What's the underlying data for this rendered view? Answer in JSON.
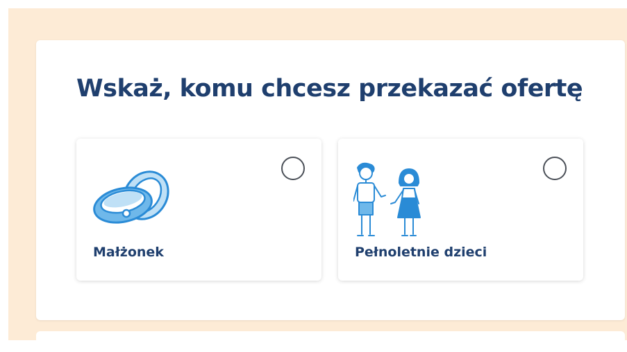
{
  "heading": "Wskaż, komu chcesz przekazać ofertę",
  "options": [
    {
      "label": "Małżonek",
      "icon": "wedding-rings-icon",
      "selected": false
    },
    {
      "label": "Pełnoletnie dzieci",
      "icon": "adult-children-icon",
      "selected": false
    }
  ],
  "colors": {
    "page_background": "#fdebd6",
    "heading": "#1f3f6e",
    "illustration_blue": "#2a8bd6",
    "illustration_light": "#bfe0f6"
  }
}
